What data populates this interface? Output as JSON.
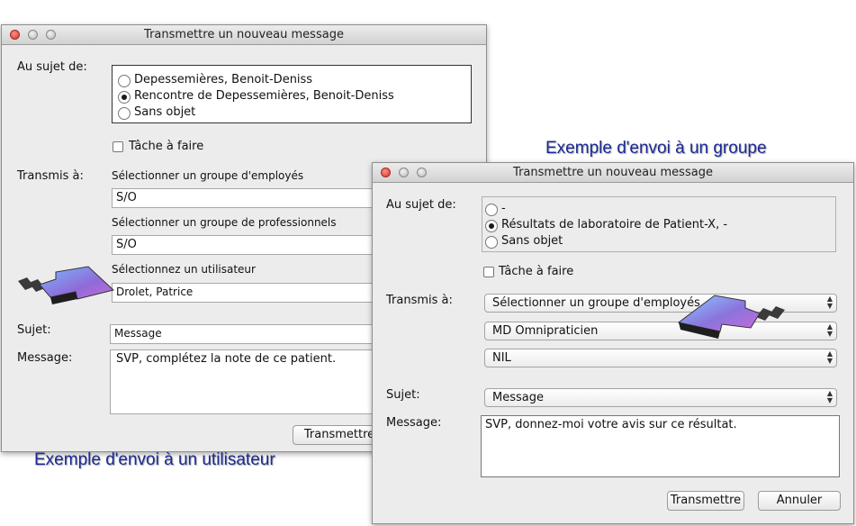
{
  "window1": {
    "title": "Transmettre un nouveau message",
    "about_label": "Au sujet de:",
    "about_options": [
      {
        "label": "Depessemières, Benoit-Deniss",
        "selected": false
      },
      {
        "label": "Rencontre de Depessemières, Benoit-Deniss",
        "selected": true
      },
      {
        "label": "Sans objet",
        "selected": false
      }
    ],
    "task_label": "Tâche à faire",
    "transmitted_label": "Transmis à:",
    "employee_group_label": "Sélectionner un groupe d'employés",
    "employee_group_value": "S/O",
    "professional_group_label": "Sélectionner un groupe de professionnels",
    "professional_group_value": "S/O",
    "user_label": "Sélectionnez un utilisateur",
    "user_value": "Drolet, Patrice",
    "subject_label": "Sujet:",
    "subject_value": "Message",
    "message_label": "Message:",
    "message_value": "SVP, complétez la note de ce patient.",
    "send_button": "Transmettre"
  },
  "window2": {
    "title": "Transmettre un nouveau message",
    "about_label": "Au sujet de:",
    "about_options": [
      {
        "label": "-",
        "selected": false
      },
      {
        "label": "Résultats de laboratoire de Patient-X, -",
        "selected": true
      },
      {
        "label": "Sans objet",
        "selected": false
      }
    ],
    "task_label": "Tâche à faire",
    "transmitted_label": "Transmis à:",
    "employee_group_value": "Sélectionner un groupe d'employés",
    "professional_value": "MD Omnipraticien",
    "user_value": "NIL",
    "subject_label": "Sujet:",
    "subject_value": "Message",
    "message_label": "Message:",
    "message_value": "SVP, donnez-moi votre avis sur ce résultat.",
    "send_button": "Transmettre",
    "cancel_button": "Annuler"
  },
  "captions": {
    "group_example": "Exemple d'envoi à un groupe",
    "user_example": "Exemple d'envoi à un utilisateur"
  }
}
